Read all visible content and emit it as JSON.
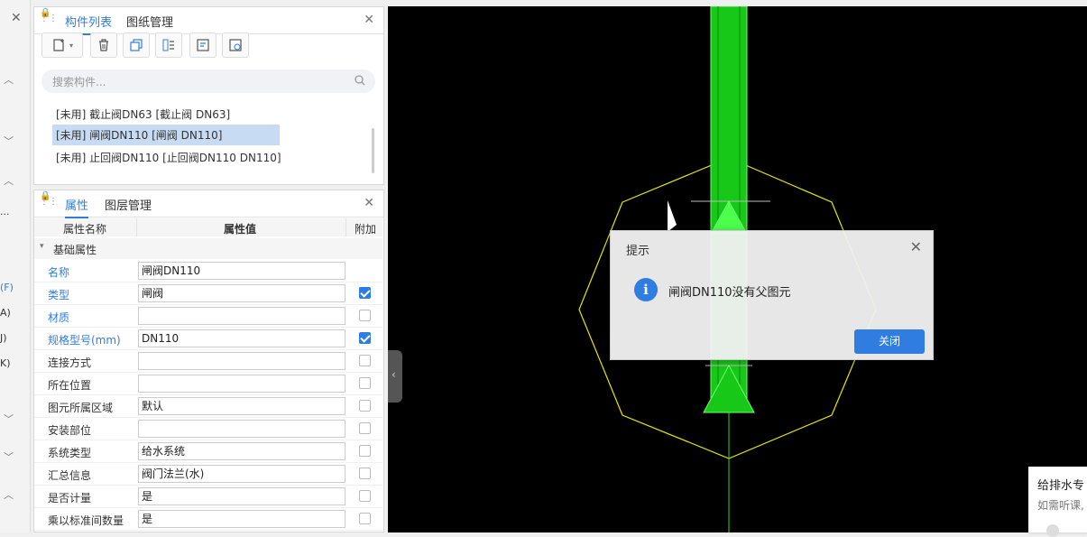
{
  "component_panel": {
    "tabs": [
      "构件列表",
      "图纸管理"
    ],
    "search_placeholder": "搜索构件...",
    "items": [
      "[未用] 截止阀DN63 [截止阀 DN63]",
      "[未用] 闸阀DN110 [闸阀 DN110]",
      "[未用] 止回阀DN110 [止回阀DN110 DN110]"
    ],
    "selected_index": 1
  },
  "property_panel": {
    "tabs": [
      "属性",
      "图层管理"
    ],
    "headers": {
      "name": "属性名称",
      "value": "属性值",
      "extra": "附加"
    },
    "group": "基础属性",
    "rows": [
      {
        "name": "名称",
        "value": "闸阀DN110",
        "checked": null
      },
      {
        "name": "类型",
        "value": "闸阀",
        "checked": true
      },
      {
        "name": "材质",
        "value": "",
        "checked": false
      },
      {
        "name": "规格型号(mm)",
        "value": "DN110",
        "checked": true
      },
      {
        "name": "连接方式",
        "value": "",
        "checked": false
      },
      {
        "name": "所在位置",
        "value": "",
        "checked": false
      },
      {
        "name": "图元所属区域",
        "value": "默认",
        "checked": false
      },
      {
        "name": "安装部位",
        "value": "",
        "checked": false
      },
      {
        "name": "系统类型",
        "value": "给水系统",
        "checked": false
      },
      {
        "name": "汇总信息",
        "value": "阀门法兰(水)",
        "checked": false
      },
      {
        "name": "是否计量",
        "value": "是",
        "checked": false
      },
      {
        "name": "乘以标准间数量",
        "value": "是",
        "checked": false
      }
    ]
  },
  "left_strip": {
    "close": "✕",
    "labels": [
      "(F)",
      "A)",
      "J)",
      "K)",
      "...",
      "."
    ]
  },
  "dialog": {
    "title": "提示",
    "icon": "info-icon",
    "message": "闸阀DN110没有父图元",
    "close_button": "关闭"
  },
  "side_card": {
    "title": "给排水专",
    "subtitle": "如需听课,"
  },
  "colors": {
    "accent": "#2f7de1",
    "canvas_bg": "#000000",
    "pipe": "#22dd22",
    "outline": "#e6e600"
  }
}
